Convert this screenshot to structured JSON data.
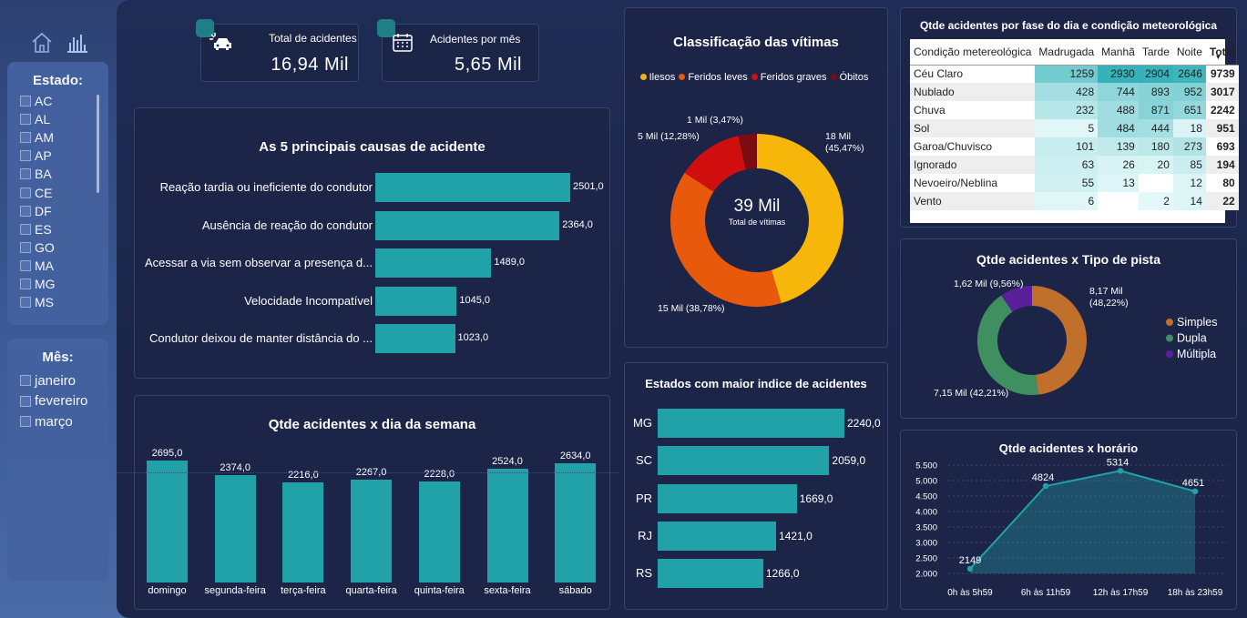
{
  "sidebar": {
    "estado_title": "Estado:",
    "estados": [
      "AC",
      "AL",
      "AM",
      "AP",
      "BA",
      "CE",
      "DF",
      "ES",
      "GO",
      "MA",
      "MG",
      "MS"
    ],
    "mes_title": "Mês:",
    "meses": [
      "janeiro",
      "fevereiro",
      "março"
    ]
  },
  "kpis": [
    {
      "label": "Total de acidentes",
      "value": "16,94 Mil",
      "icon": "car-crash-icon"
    },
    {
      "label": "Acidentes por mês",
      "value": "5,65 Mil",
      "icon": "calendar-icon"
    }
  ],
  "causas": {
    "title": "As 5 principais causas de acidente",
    "chart_data": {
      "type": "bar",
      "orientation": "horizontal",
      "categories": [
        "Reação tardia ou ineficiente do condutor",
        "Ausência de reação do condutor",
        "Acessar a via sem observar a presença d...",
        "Velocidade Incompatível",
        "Condutor deixou de manter distância do ..."
      ],
      "values": [
        2501,
        2364,
        1489,
        1045,
        1023
      ],
      "labels": [
        "2501,0",
        "2364,0",
        "1489,0",
        "1045,0",
        "1023,0"
      ],
      "color": "#21a1a8"
    }
  },
  "semana": {
    "title": "Qtde acidentes x dia da semana",
    "chart_data": {
      "type": "bar",
      "categories": [
        "domingo",
        "segunda-feira",
        "terça-feira",
        "quarta-feira",
        "quinta-feira",
        "sexta-feira",
        "sábado"
      ],
      "values": [
        2695,
        2374,
        2216,
        2267,
        2228,
        2524,
        2634
      ],
      "labels": [
        "2695,0",
        "2374,0",
        "2216,0",
        "2267,0",
        "2228,0",
        "2524,0",
        "2634,0"
      ],
      "color": "#21a1a8"
    }
  },
  "vitimas": {
    "title": "Classificação das vítimas",
    "center_value": "39 Mil",
    "center_label": "Total de vítimas",
    "chart_data": {
      "type": "pie",
      "categories": [
        "Ilesos",
        "Feridos leves",
        "Feridos graves",
        "Óbitos"
      ],
      "values": [
        45.47,
        38.78,
        12.28,
        3.47
      ],
      "labels": [
        "18 Mil (45,47%)",
        "15 Mil (38,78%)",
        "5 Mil (12,28%)",
        "1 Mil (3,47%)"
      ],
      "colors": [
        "#f6b70a",
        "#e9590c",
        "#d10e0e",
        "#7b0d12"
      ]
    }
  },
  "estados": {
    "title": "Estados com maior indice de acidentes",
    "chart_data": {
      "type": "bar",
      "orientation": "horizontal",
      "categories": [
        "MG",
        "SC",
        "PR",
        "RJ",
        "RS"
      ],
      "values": [
        2240,
        2059,
        1669,
        1421,
        1266
      ],
      "labels": [
        "2240,0",
        "2059,0",
        "1669,0",
        "1421,0",
        "1266,0"
      ],
      "color": "#21a1a8"
    }
  },
  "matriz": {
    "title": "Qtde acidentes por fase do dia e condição meteorológica",
    "chart_data": {
      "type": "table",
      "columns": [
        "Condição metereológica",
        "Madrugada",
        "Manhã",
        "Tarde",
        "Noite",
        "Total"
      ],
      "rows": [
        [
          "Céu Claro",
          "1259",
          "2930",
          "2904",
          "2646",
          "9739"
        ],
        [
          "Nublado",
          "428",
          "744",
          "893",
          "952",
          "3017"
        ],
        [
          "Chuva",
          "232",
          "488",
          "871",
          "651",
          "2242"
        ],
        [
          "Sol",
          "5",
          "484",
          "444",
          "18",
          "951"
        ],
        [
          "Garoa/Chuvisco",
          "101",
          "139",
          "180",
          "273",
          "693"
        ],
        [
          "Ignorado",
          "63",
          "26",
          "20",
          "85",
          "194"
        ],
        [
          "Nevoeiro/Neblina",
          "55",
          "13",
          "",
          "12",
          "80"
        ],
        [
          "Vento",
          "6",
          "",
          "2",
          "14",
          "22"
        ]
      ],
      "sort_indicator": "▼"
    }
  },
  "pista": {
    "title": "Qtde acidentes x Tipo de pista",
    "chart_data": {
      "type": "pie",
      "categories": [
        "Simples",
        "Dupla",
        "Múltipla"
      ],
      "values": [
        48.22,
        42.21,
        9.56
      ],
      "labels": [
        "8,17 Mil (48,22%)",
        "7,15 Mil (42,21%)",
        "1,62 Mil (9,56%)"
      ],
      "colors": [
        "#c0702a",
        "#3f8f61",
        "#5a1f9a"
      ]
    }
  },
  "horario": {
    "title": "Qtde acidentes x horário",
    "chart_data": {
      "type": "area",
      "categories": [
        "0h às 5h59",
        "6h às 11h59",
        "12h às 17h59",
        "18h às 23h59"
      ],
      "values": [
        2149,
        4824,
        5314,
        4651
      ],
      "labels": [
        "2149",
        "4824",
        "5314",
        "4651"
      ],
      "yticks": [
        "5.500",
        "5.000",
        "4.500",
        "4.000",
        "3.500",
        "3.000",
        "2.500",
        "2.000"
      ],
      "ylim": [
        2000,
        5500
      ],
      "color": "#21a1a8"
    }
  },
  "nav_icons": [
    "home-icon",
    "bar-chart-icon"
  ]
}
